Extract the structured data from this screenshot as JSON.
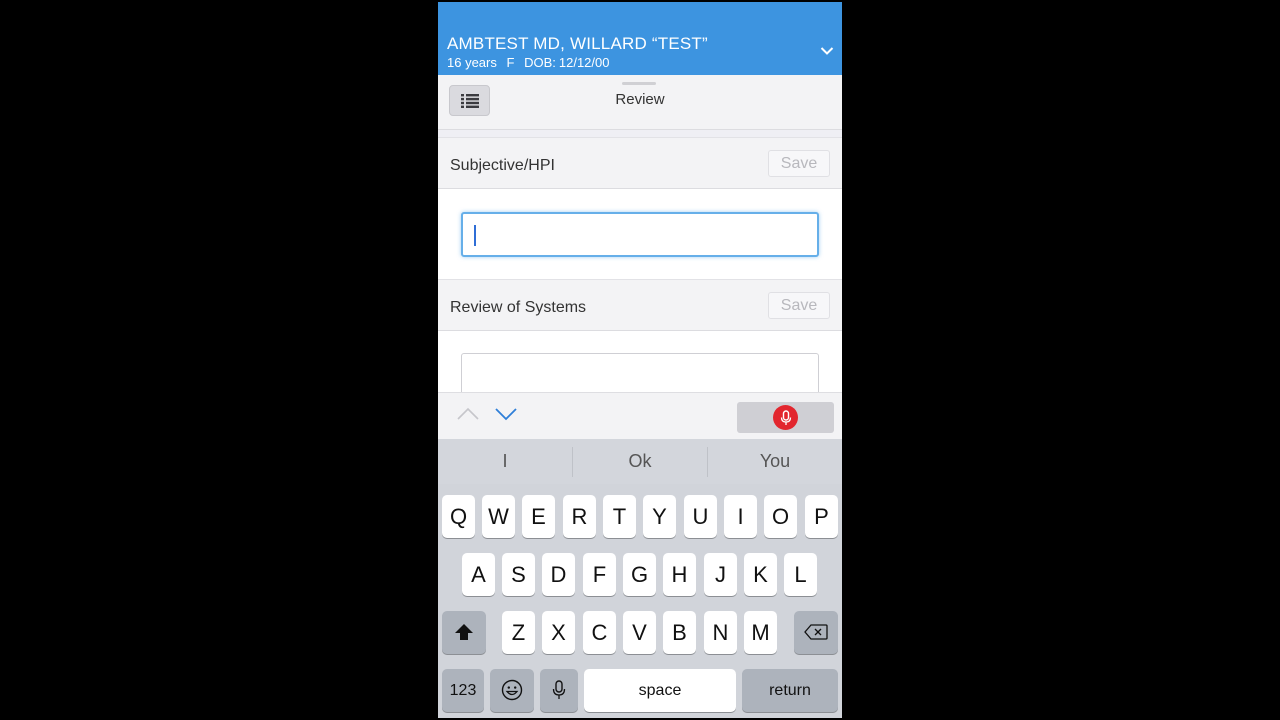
{
  "patient": {
    "name": "AMBTEST MD, WILLARD “TEST”",
    "age": "16 years",
    "sex": "F",
    "dob_label": "DOB:",
    "dob": "12/12/00"
  },
  "toolbar": {
    "title": "Review"
  },
  "sections": [
    {
      "title": "Subjective/HPI",
      "save_label": "Save",
      "value": ""
    },
    {
      "title": "Review of Systems",
      "save_label": "Save",
      "value": ""
    }
  ],
  "keyboard": {
    "predictions": [
      "I",
      "Ok",
      "You"
    ],
    "row1": [
      "Q",
      "W",
      "E",
      "R",
      "T",
      "Y",
      "U",
      "I",
      "O",
      "P"
    ],
    "row2": [
      "A",
      "S",
      "D",
      "F",
      "G",
      "H",
      "J",
      "K",
      "L"
    ],
    "row3": [
      "Z",
      "X",
      "C",
      "V",
      "B",
      "N",
      "M"
    ],
    "numbers_label": "123",
    "space_label": "space",
    "return_label": "return"
  },
  "colors": {
    "header": "#3d94e0",
    "accent": "#2f6ed6",
    "mic": "#e2262e"
  }
}
